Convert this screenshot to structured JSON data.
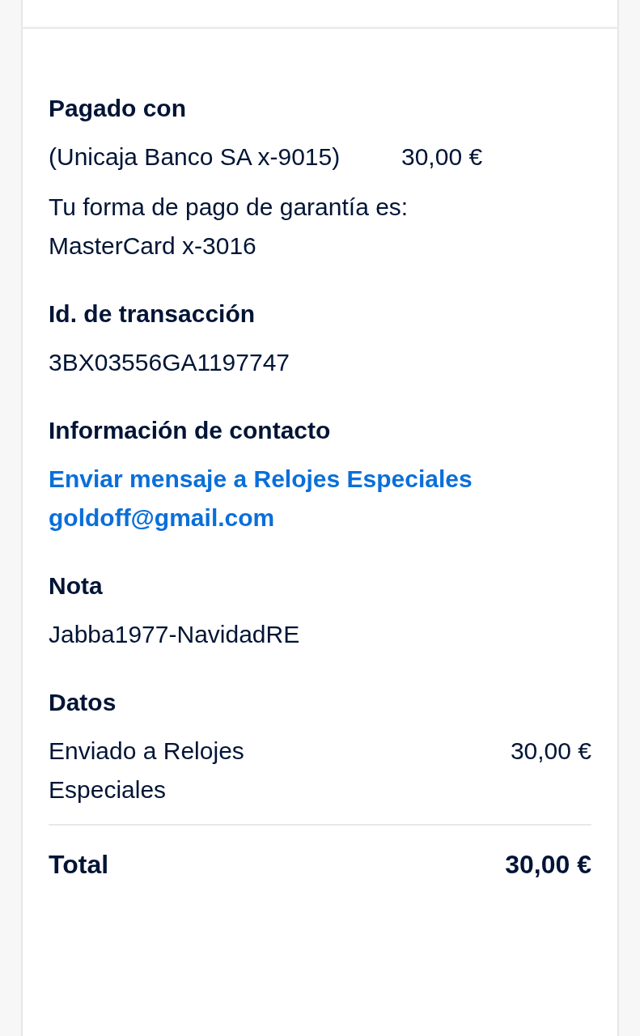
{
  "paid_with": {
    "title": "Pagado con",
    "source": "(Unicaja Banco SA x-9015)",
    "amount": "30,00 €",
    "backup_note": "Tu forma de pago de garantía es: MasterCard x-3016"
  },
  "transaction": {
    "title": "Id. de transacción",
    "id": "3BX03556GA1197747"
  },
  "contact": {
    "title": "Información de contacto",
    "links": [
      "Enviar mensaje a Relojes Especiales",
      "goldoff@gmail.com"
    ]
  },
  "note": {
    "title": "Nota",
    "text": "Jabba1977-NavidadRE"
  },
  "details": {
    "title": "Datos",
    "rows": [
      {
        "label": "Enviado a Relojes Especiales",
        "amount": "30,00 €"
      }
    ],
    "total": {
      "label": "Total",
      "amount": "30,00 €"
    }
  }
}
